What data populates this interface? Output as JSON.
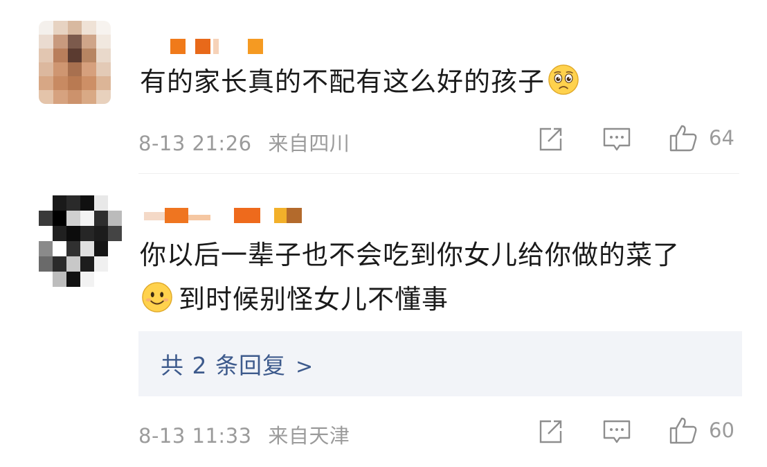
{
  "comments": [
    {
      "text": "有的家长真的不配有这么好的孩子",
      "emoji": "sad-pleading-emoji",
      "time": "8-13 21:26",
      "location": "来自四川",
      "likes": "64"
    },
    {
      "text_line1": "你以后一辈子也不会吃到你女儿给你做的菜了",
      "emoji": "smile-emoji",
      "text_line2": "到时候别怪女儿不懂事",
      "replies_label": "共 2 条回复",
      "replies_chevron": ">",
      "time": "8-13 11:33",
      "location": "来自天津",
      "likes": "60"
    }
  ],
  "icons": {
    "share": "share-icon",
    "comment": "comment-icon",
    "like": "thumbs-up-icon"
  },
  "colors": {
    "text": "#1a1a1a",
    "meta": "#9b9b9b",
    "link": "#3d5a8c",
    "reply_bg": "#f2f4f8",
    "username_orange": "#f07a1a"
  }
}
